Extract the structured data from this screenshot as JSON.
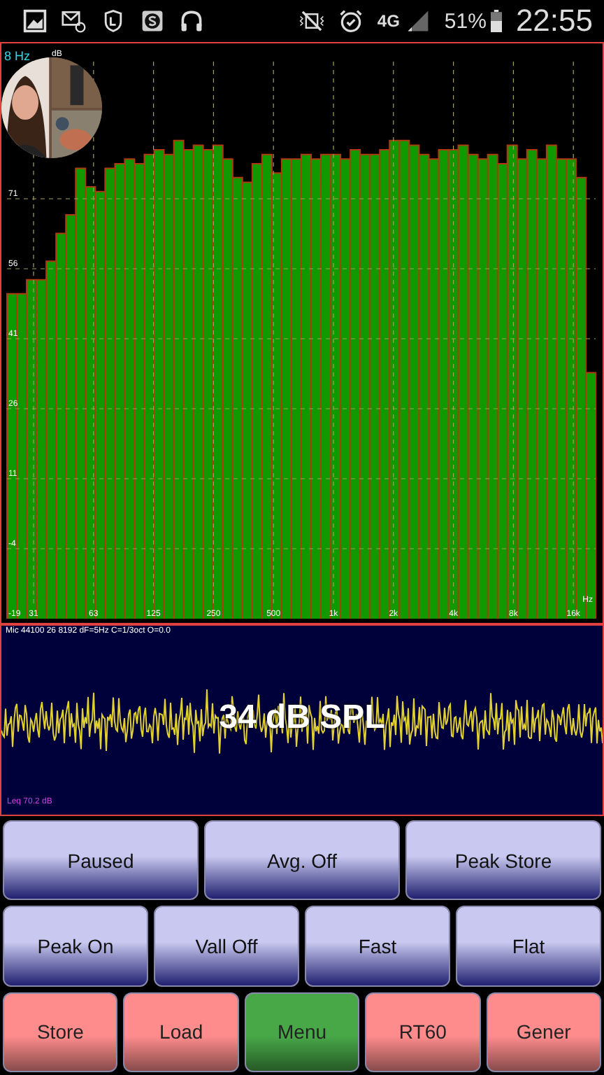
{
  "status_bar": {
    "network": "4G",
    "battery": "51%",
    "time": "22:55"
  },
  "spectrum": {
    "top_label": "8 Hz",
    "unit_top": "dB",
    "unit_bottom": "Hz",
    "bottom_left_label": "-19",
    "y_labels": [
      "71",
      "56",
      "41",
      "26",
      "11",
      "-4"
    ],
    "x_labels": [
      "31",
      "63",
      "125",
      "250",
      "500",
      "1k",
      "2k",
      "4k",
      "8k",
      "16k"
    ]
  },
  "level_panel": {
    "info": "Mic 44100 26 8192 dF=5Hz C=1/3oct O=0.0",
    "reading": "34 dB SPL",
    "leq": "Leq 70.2 dB"
  },
  "button_rows": [
    [
      {
        "label": "Paused",
        "color": "#c8c8f0"
      },
      {
        "label": "Avg. Off",
        "color": "#c8c8f0"
      },
      {
        "label": "Peak Store",
        "color": "#c8c8f0"
      }
    ],
    [
      {
        "label": "Peak On",
        "color": "#c8c8f0"
      },
      {
        "label": "Vall Off",
        "color": "#c8c8f0"
      },
      {
        "label": "Fast",
        "color": "#c8c8f0"
      },
      {
        "label": "Flat",
        "color": "#c8c8f0"
      }
    ],
    [
      {
        "label": "Store",
        "color": "#ff8c8c"
      },
      {
        "label": "Load",
        "color": "#ff8c8c"
      },
      {
        "label": "Menu",
        "color": "#48a848"
      },
      {
        "label": "RT60",
        "color": "#ff8c8c"
      },
      {
        "label": "Gener",
        "color": "#ff8c8c"
      }
    ]
  ]
}
